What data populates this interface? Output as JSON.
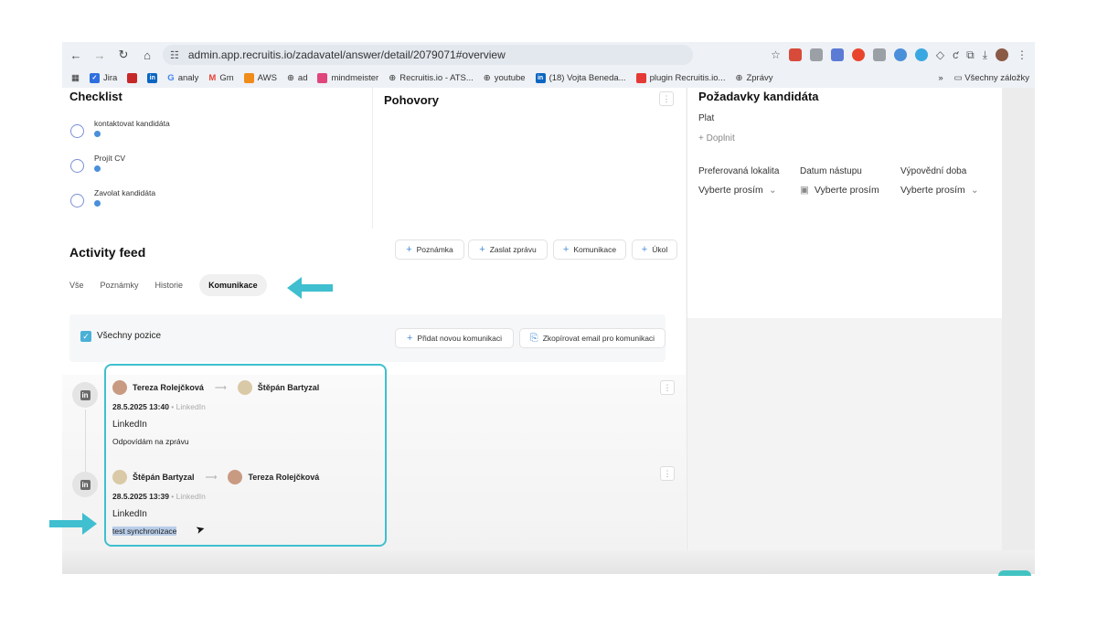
{
  "browser": {
    "url": "admin.app.recruitis.io/zadavatel/answer/detail/2079071#overview",
    "bookmarks": [
      "Jira",
      "",
      "",
      "analy",
      "Gm",
      "AWS",
      "ad",
      "mindmeister",
      "Recruitis.io - ATS...",
      "youtube",
      "(18) Vojta Beneda...",
      "plugin Recruitis.io...",
      "Zprávy"
    ],
    "bookmarks_more": "»",
    "all_bookmarks": "Všechny záložky"
  },
  "checklist": {
    "title": "Checklist",
    "items": [
      "kontaktovat kandidáta",
      "Projít CV",
      "Zavolat kandidáta"
    ]
  },
  "interviews": {
    "title": "Pohovory"
  },
  "requirements": {
    "title": "Požadavky kandidáta",
    "salary_label": "Plat",
    "add_label": "+ Doplnit",
    "location_label": "Preferovaná lokalita",
    "start_label": "Datum nástupu",
    "notice_label": "Výpovědní doba",
    "location_value": "Vyberte prosím",
    "start_value": "Vyberte prosím",
    "notice_value": "Vyberte prosím"
  },
  "feed": {
    "title": "Activity feed",
    "buttons": [
      "Poznámka",
      "Zaslat zprávu",
      "Komunikace",
      "Úkol"
    ],
    "tabs": [
      "Vše",
      "Poznámky",
      "Historie",
      "Komunikace"
    ],
    "active_tab": "Komunikace",
    "filter_label": "Všechny pozice",
    "add_comm": "Přidat novou komunikaci",
    "copy_email": "Zkopírovat email pro komunikaci",
    "messages": [
      {
        "from": "Tereza Rolejčková",
        "to": "Štěpán Bartyzal",
        "date": "28.5.2025 13:40",
        "source": "LinkedIn",
        "channel": "LinkedIn",
        "text": "Odpovídám na zprávu"
      },
      {
        "from": "Štěpán Bartyzal",
        "to": "Tereza Rolejčková",
        "date": "28.5.2025 13:39",
        "source": "LinkedIn",
        "channel": "LinkedIn",
        "text": "test synchronizace"
      }
    ]
  },
  "colors": {
    "accent": "#3fbfcf",
    "link_blue": "#4a8fd9"
  }
}
